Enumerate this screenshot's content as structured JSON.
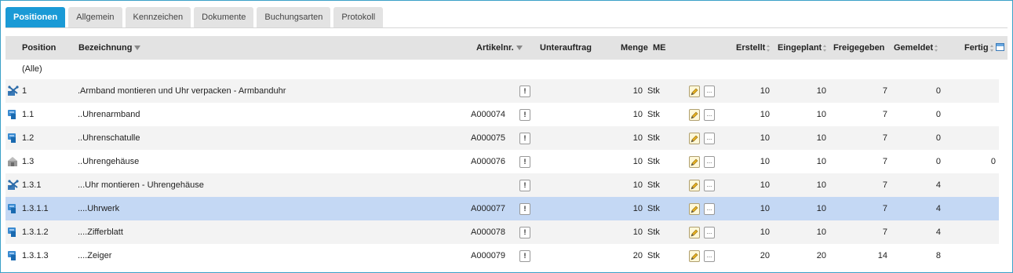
{
  "tabs": [
    "Positionen",
    "Allgemein",
    "Kennzeichen",
    "Dokumente",
    "Buchungsarten",
    "Protokoll"
  ],
  "columns": {
    "position": "Position",
    "bezeichnung": "Bezeichnung",
    "artikelnr": "Artikelnr.",
    "unterauftrag": "Unterauftrag",
    "menge": "Menge",
    "me": "ME",
    "erstellt": "Erstellt",
    "eingeplant": "Eingeplant",
    "freigegeben": "Freigegeben",
    "gemeldet": "Gemeldet",
    "fertig": "Fertig"
  },
  "filter_all": "(Alle)",
  "rows": [
    {
      "icon": "assembly-icon",
      "position": "1",
      "bezeichnung": ".Armband montieren und Uhr verpacken - Armbanduhr",
      "artikelnr": "",
      "excl": "!",
      "menge": "10",
      "me": "Stk",
      "dots": "...",
      "erstellt": "10",
      "eingeplant": "10",
      "freigegeben": "7",
      "gemeldet": "0",
      "fertig": ""
    },
    {
      "icon": "purchase-icon",
      "position": "1.1",
      "bezeichnung": "..Uhrenarmband",
      "artikelnr": "A000074",
      "excl": "!",
      "menge": "10",
      "me": "Stk",
      "dots": "...",
      "erstellt": "10",
      "eingeplant": "10",
      "freigegeben": "7",
      "gemeldet": "0",
      "fertig": ""
    },
    {
      "icon": "purchase-icon",
      "position": "1.2",
      "bezeichnung": "..Uhrenschatulle",
      "artikelnr": "A000075",
      "excl": "!",
      "menge": "10",
      "me": "Stk",
      "dots": "...",
      "erstellt": "10",
      "eingeplant": "10",
      "freigegeben": "7",
      "gemeldet": "0",
      "fertig": ""
    },
    {
      "icon": "stock-icon",
      "position": "1.3",
      "bezeichnung": "..Uhrengehäuse",
      "artikelnr": "A000076",
      "excl": "!",
      "menge": "10",
      "me": "Stk",
      "dots": "...",
      "erstellt": "10",
      "eingeplant": "10",
      "freigegeben": "7",
      "gemeldet": "0",
      "fertig": "0"
    },
    {
      "icon": "assembly-icon",
      "position": "1.3.1",
      "bezeichnung": "...Uhr montieren - Uhrengehäuse",
      "artikelnr": "",
      "excl": "!",
      "menge": "10",
      "me": "Stk",
      "dots": "...",
      "erstellt": "10",
      "eingeplant": "10",
      "freigegeben": "7",
      "gemeldet": "4",
      "fertig": ""
    },
    {
      "icon": "purchase-icon",
      "position": "1.3.1.1",
      "bezeichnung": "....Uhrwerk",
      "artikelnr": "A000077",
      "excl": "!",
      "menge": "10",
      "me": "Stk",
      "dots": "...",
      "erstellt": "10",
      "eingeplant": "10",
      "freigegeben": "7",
      "gemeldet": "4",
      "fertig": ""
    },
    {
      "icon": "purchase-icon",
      "position": "1.3.1.2",
      "bezeichnung": "....Zifferblatt",
      "artikelnr": "A000078",
      "excl": "!",
      "menge": "10",
      "me": "Stk",
      "dots": "...",
      "erstellt": "10",
      "eingeplant": "10",
      "freigegeben": "7",
      "gemeldet": "4",
      "fertig": ""
    },
    {
      "icon": "purchase-icon",
      "position": "1.3.1.3",
      "bezeichnung": "....Zeiger",
      "artikelnr": "A000079",
      "excl": "!",
      "menge": "20",
      "me": "Stk",
      "dots": "...",
      "erstellt": "20",
      "eingeplant": "20",
      "freigegeben": "14",
      "gemeldet": "8",
      "fertig": ""
    }
  ],
  "selected_row": 5,
  "colors": {
    "accent": "#1a9ad6",
    "selected": "#c4d8f4",
    "border": "#3aa0c8"
  }
}
